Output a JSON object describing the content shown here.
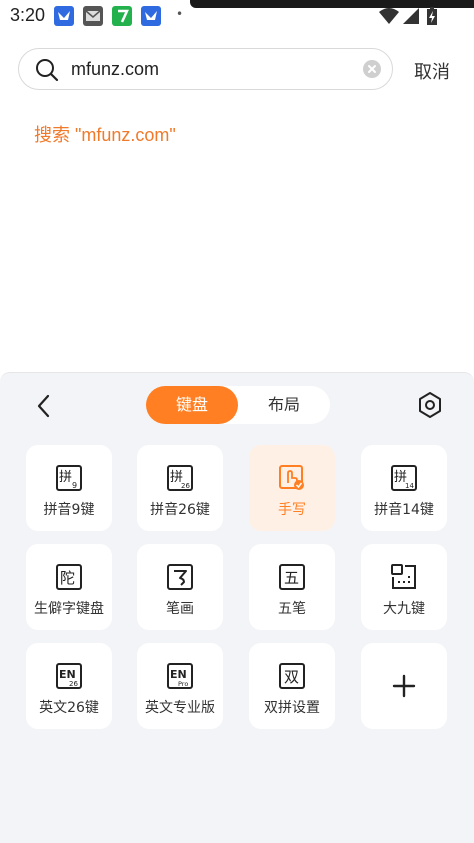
{
  "status_bar": {
    "time": "3:20",
    "notifications": [
      "feishu-icon",
      "mail-icon",
      "app-7-icon",
      "feishu-icon"
    ],
    "dot": "•"
  },
  "search": {
    "value": "mfunz.com",
    "cancel_label": "取消"
  },
  "suggestion": {
    "text": "搜索 \"mfunz.com\""
  },
  "keyboard_panel": {
    "tabs": [
      {
        "label": "键盘",
        "active": true
      },
      {
        "label": "布局",
        "active": false
      }
    ],
    "tiles": [
      {
        "label": "拼音9键",
        "icon": "pinyin-9-icon",
        "selected": false
      },
      {
        "label": "拼音26键",
        "icon": "pinyin-26-icon",
        "selected": false
      },
      {
        "label": "手写",
        "icon": "handwriting-icon",
        "selected": true
      },
      {
        "label": "拼音14键",
        "icon": "pinyin-14-icon",
        "selected": false
      },
      {
        "label": "生僻字键盘",
        "icon": "rare-char-icon",
        "selected": false
      },
      {
        "label": "笔画",
        "icon": "stroke-icon",
        "selected": false
      },
      {
        "label": "五笔",
        "icon": "wubi-icon",
        "selected": false
      },
      {
        "label": "大九键",
        "icon": "big-nine-icon",
        "selected": false
      },
      {
        "label": "英文26键",
        "icon": "english-26-icon",
        "selected": false
      },
      {
        "label": "英文专业版",
        "icon": "english-pro-icon",
        "selected": false
      },
      {
        "label": "双拼设置",
        "icon": "shuangpin-icon",
        "selected": false
      },
      {
        "label": "",
        "icon": "plus-icon",
        "selected": false
      }
    ],
    "icon_glyphs": {
      "pinyin": "拼",
      "pinyin_9_sub": "9",
      "pinyin_26_sub": "26",
      "pinyin_14_sub": "14",
      "rare": "陀",
      "stroke": "㇉",
      "wubi": "五",
      "en": "EN",
      "en_26_sub": "26",
      "en_pro_sub": "Pro",
      "shuang": "双"
    }
  },
  "colors": {
    "accent": "#ff7f22",
    "suggestion": "#f07a2a",
    "panel_bg": "#f3f4f8",
    "selected_tile_bg": "#fff0e6"
  }
}
